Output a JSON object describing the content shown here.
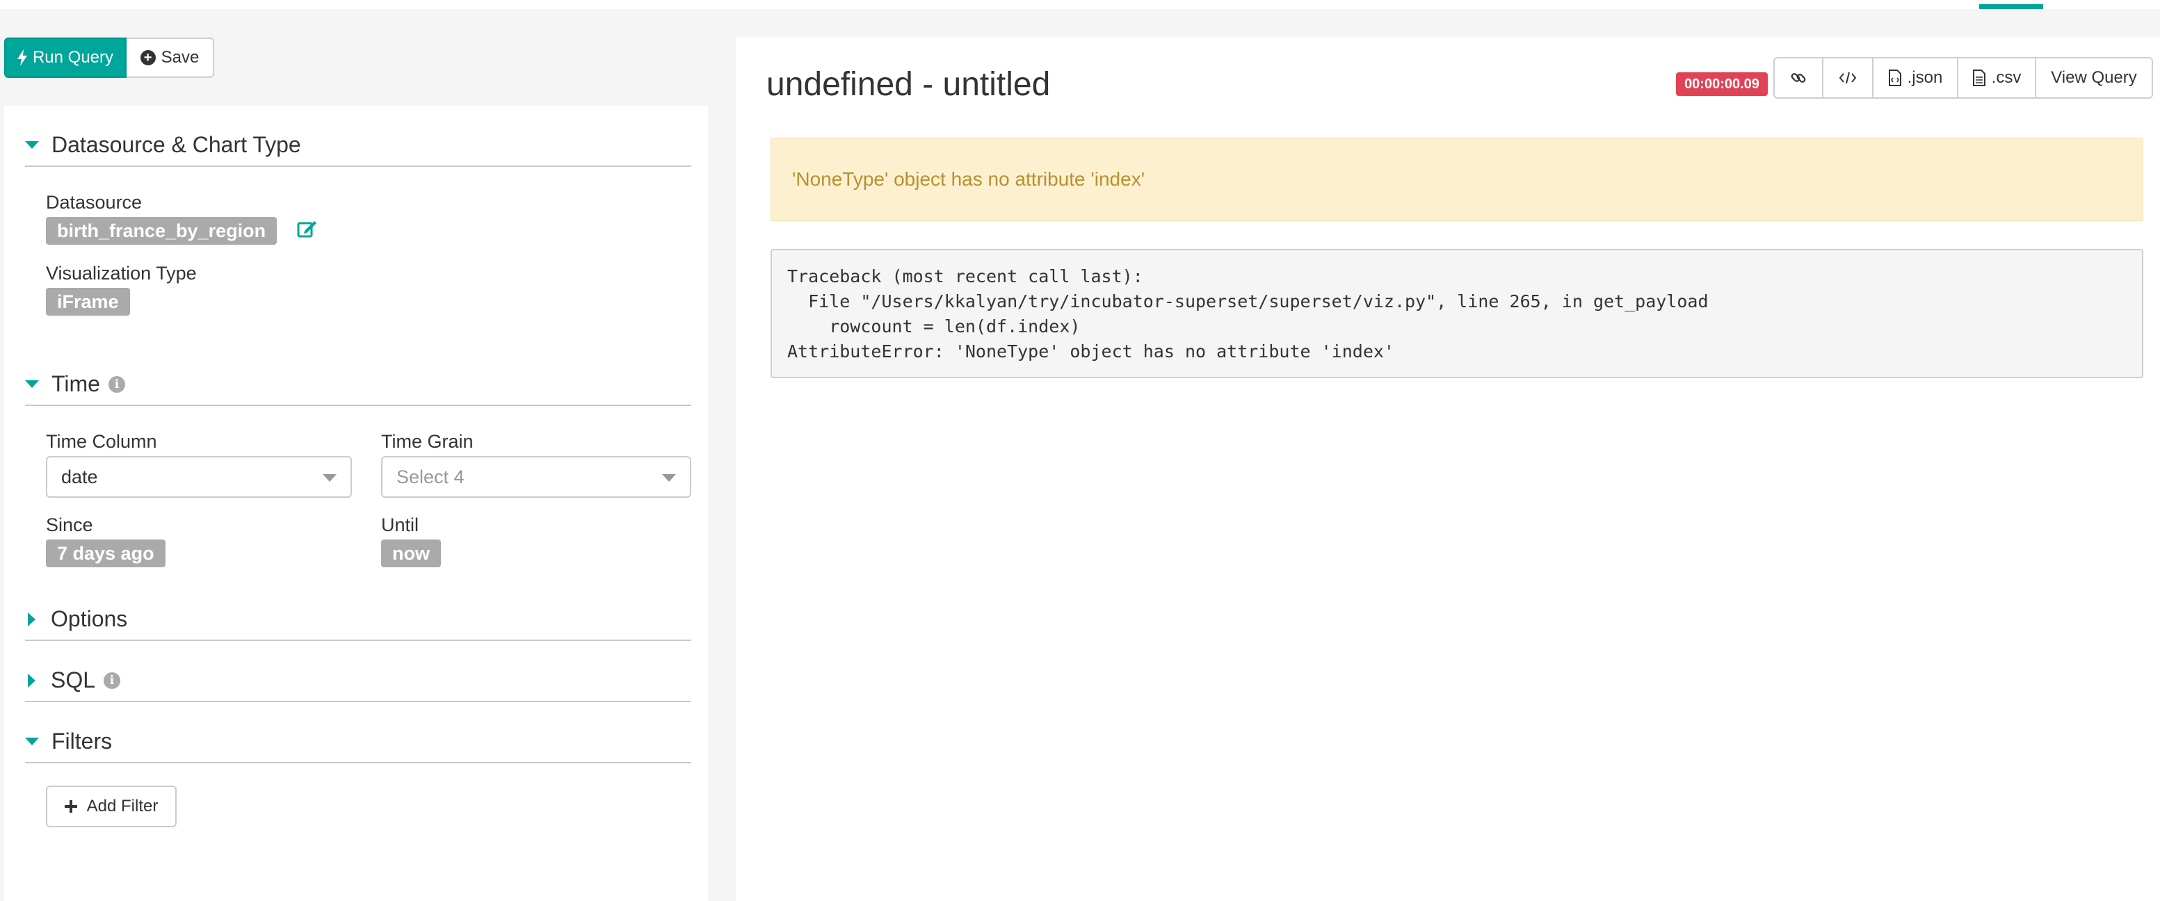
{
  "toolbar": {
    "run_query_label": "Run Query",
    "save_label": "Save"
  },
  "sections": {
    "datasource": {
      "title": "Datasource & Chart Type",
      "datasource_label": "Datasource",
      "datasource_value": "birth_france_by_region",
      "viz_type_label": "Visualization Type",
      "viz_type_value": "iFrame"
    },
    "time": {
      "title": "Time",
      "time_column_label": "Time Column",
      "time_column_value": "date",
      "time_grain_label": "Time Grain",
      "time_grain_placeholder": "Select 4",
      "since_label": "Since",
      "since_value": "7 days ago",
      "until_label": "Until",
      "until_value": "now"
    },
    "options": {
      "title": "Options"
    },
    "sql": {
      "title": "SQL"
    },
    "filters": {
      "title": "Filters",
      "add_filter_label": "Add Filter"
    }
  },
  "chart": {
    "title": "undefined - untitled",
    "timer": "00:00:00.09",
    "buttons": {
      "json": ".json",
      "csv": ".csv",
      "view_query": "View Query"
    },
    "error_message": "'NoneType' object has no attribute 'index'",
    "traceback": "Traceback (most recent call last):\n  File \"/Users/kkalyan/try/incubator-superset/superset/viz.py\", line 265, in get_payload\n    rowcount = len(df.index)\nAttributeError: 'NoneType' object has no attribute 'index'"
  },
  "colors": {
    "accent": "#00a699",
    "timer": "#e04355",
    "alert_bg": "#fdf0cf",
    "alert_text": "#b89033",
    "tag_bg": "#aaaaaa"
  },
  "icons": {
    "run": "bolt-icon",
    "save": "plus-circle-icon",
    "edit": "edit-icon",
    "info": "info-icon",
    "link": "link-icon",
    "embed": "code-icon",
    "json": "file-code-icon",
    "csv": "file-text-icon",
    "add": "plus-icon"
  }
}
